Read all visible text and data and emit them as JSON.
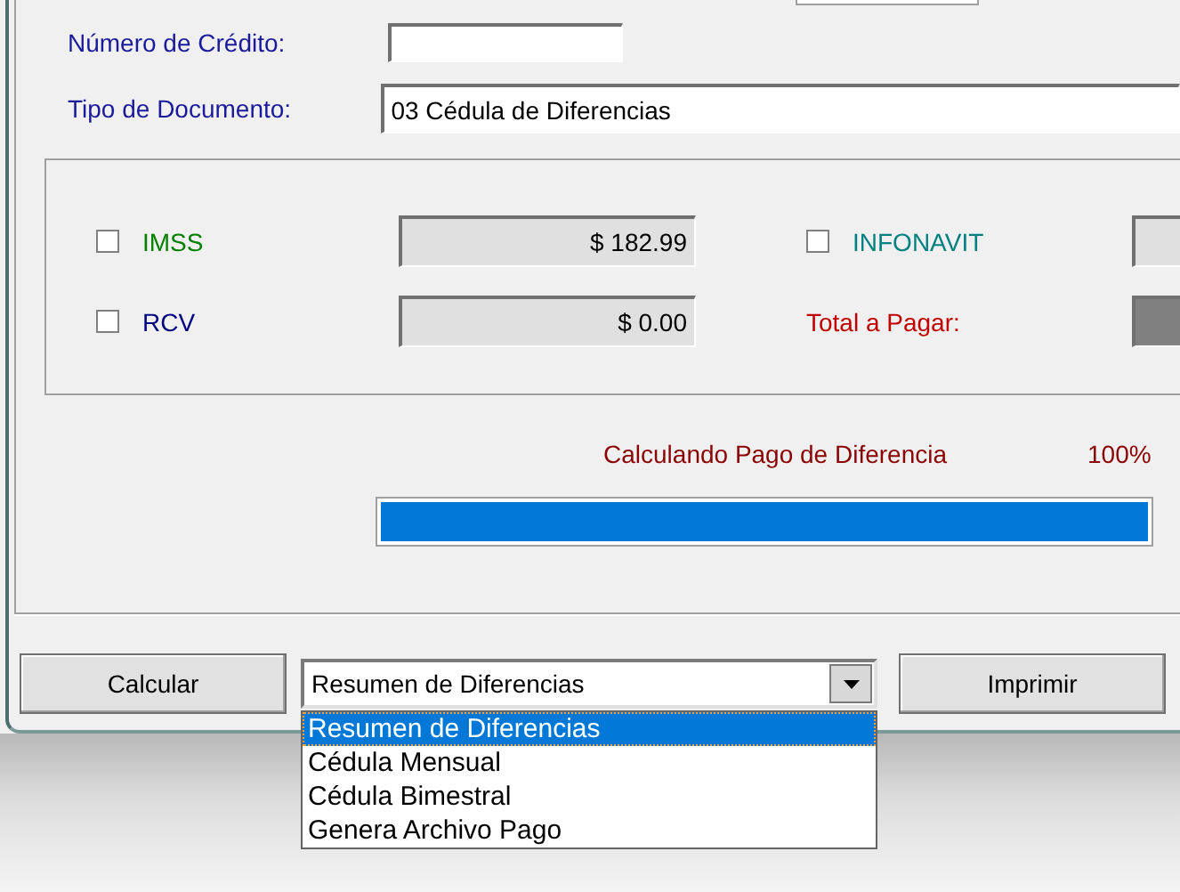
{
  "credit_number": {
    "label": "Número de Crédito:"
  },
  "document_type": {
    "label": "Tipo de Documento:",
    "value": "03 Cédula de Diferencias"
  },
  "amounts": [
    {
      "kind": "checkbox",
      "label": "IMSS",
      "checked": false,
      "color": "#008000",
      "value": "$ 182.99"
    },
    {
      "kind": "checkbox",
      "label": "INFONAVIT",
      "checked": false,
      "color": "#008080"
    },
    {
      "kind": "checkbox",
      "label": "RCV",
      "checked": false,
      "color": "#000080",
      "value": "$ 0.00"
    },
    {
      "kind": "total",
      "label": "Total a Pagar:",
      "color": "#c00000"
    }
  ],
  "progress": {
    "label": "Calculando Pago de Diferencia",
    "percent": "100%",
    "level": 1
  },
  "buttons": [
    {
      "kind": "button",
      "label": "Calcular"
    },
    {
      "kind": "combo",
      "value": "Resumen de Diferencias",
      "expanded": true,
      "options": [
        {
          "label": "Resumen de Diferencias",
          "selected": true
        },
        {
          "label": "Cédula Mensual",
          "selected": false
        },
        {
          "label": "Cédula Bimestral",
          "selected": false
        },
        {
          "label": "Genera Archivo Pago",
          "selected": false
        }
      ]
    },
    {
      "kind": "button",
      "label": "Imprimir"
    }
  ]
}
